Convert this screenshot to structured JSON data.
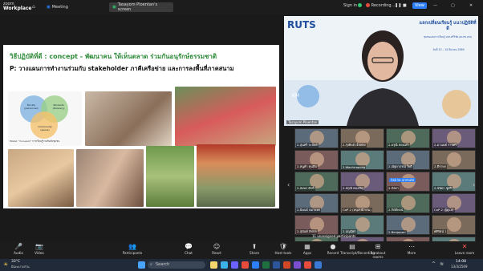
{
  "topbar": {
    "brand_small": "zoom",
    "brand_big": "Workplace",
    "tabs": [
      "Meeting",
      "Tasayom Ploentan's screen"
    ],
    "sign_in": "Sign in",
    "recording": "Recording...",
    "view": "View"
  },
  "slide": {
    "title": "วิธีปฏิบัติที่ดี : concept - พัฒนาคน ให้เห็นตลาด ร่วมกันอนุรักษ์ธรรมชาติ",
    "subtitle": "P: วางแผนการทำงานร่วมกับ stakeholder ภาคีเครือข่าย และการลงพื้นที่ภาคสนาม",
    "diagram_labels": [
      "Faculty (personnel)",
      "Students (Delivery)",
      "Community (space)"
    ],
    "model_caption": "Model: \"Co-Learn\" การเรียนรู้ร่วมกันกับชุมชน"
  },
  "presenter": {
    "name": "Tasayom Ploentan",
    "rut_logo": "RUTS",
    "banner": "แลกเปลี่ยนเรียนรู้ แนวปฏิบัติที่ดี",
    "banner_sub": "ชุมชนแห่งการเรียนรู้ มทร.ศรีวิชัย (RUTS KM)",
    "date_line": "วันที่ 13 – 14 มีนาคม 2569",
    "km": "KM"
  },
  "participants": [
    {
      "name": "2-สุนทรี จะปัยย์"
    },
    {
      "name": "2-รุ่งทิพย์ เรือฟอง"
    },
    {
      "name": "2-อรุณี ทองแก้ว"
    },
    {
      "name": "2-อานนท์ ราชศรี"
    },
    {
      "name": "2-หนูคำ ทุนอิน"
    },
    {
      "name": "2-Wachirapong"
    },
    {
      "name": "2-ณัฐยาภรณ์ ใจดี"
    },
    {
      "name": "2-ธีราพร"
    },
    {
      "name": "2-สมพร ศักดิ์"
    },
    {
      "name": "2-สกุณี คงเจริญ"
    },
    {
      "name": "2-กัลยา"
    },
    {
      "name": "2-ชนิดา ชูศรี"
    },
    {
      "name": "2-นิพนธ์ หมาแหง"
    },
    {
      "name": "CoP 2 (หนุ่งรณี พรม)"
    },
    {
      "name": "2-กิตติพจน์"
    },
    {
      "name": "CoP 2 (ผู้ดูแล)"
    },
    {
      "name": "2-สุนันท์ ลิชกล"
    },
    {
      "name": "2-ปุญญิศา"
    },
    {
      "name": "2-Benjapon"
    },
    {
      "name": "ศศิรัตน์ ว"
    },
    {
      "name": "2-รัฐภรณ์"
    },
    {
      "name": "2-ยุพวดี"
    },
    {
      "name": "2-Mattiyaporn s..."
    },
    {
      "name": "2-Mattiyaporn s..."
    }
  ],
  "grid_labels": {
    "unassigned": "11 unassigned participants",
    "ask_unmute": "Ask to unmute"
  },
  "bottombar": [
    "Audio",
    "Video",
    "Participants",
    "Chat",
    "React",
    "Share",
    "Host tools",
    "Apps",
    "Record",
    "Transcript/Recording",
    "Breakout rooms",
    "More",
    "Leave room"
  ],
  "taskbar": {
    "weather": "33°C",
    "weather_sub": "มีเมฆบางส่วน",
    "search": "Search",
    "time": "14:08",
    "date": "13/3/2569"
  }
}
